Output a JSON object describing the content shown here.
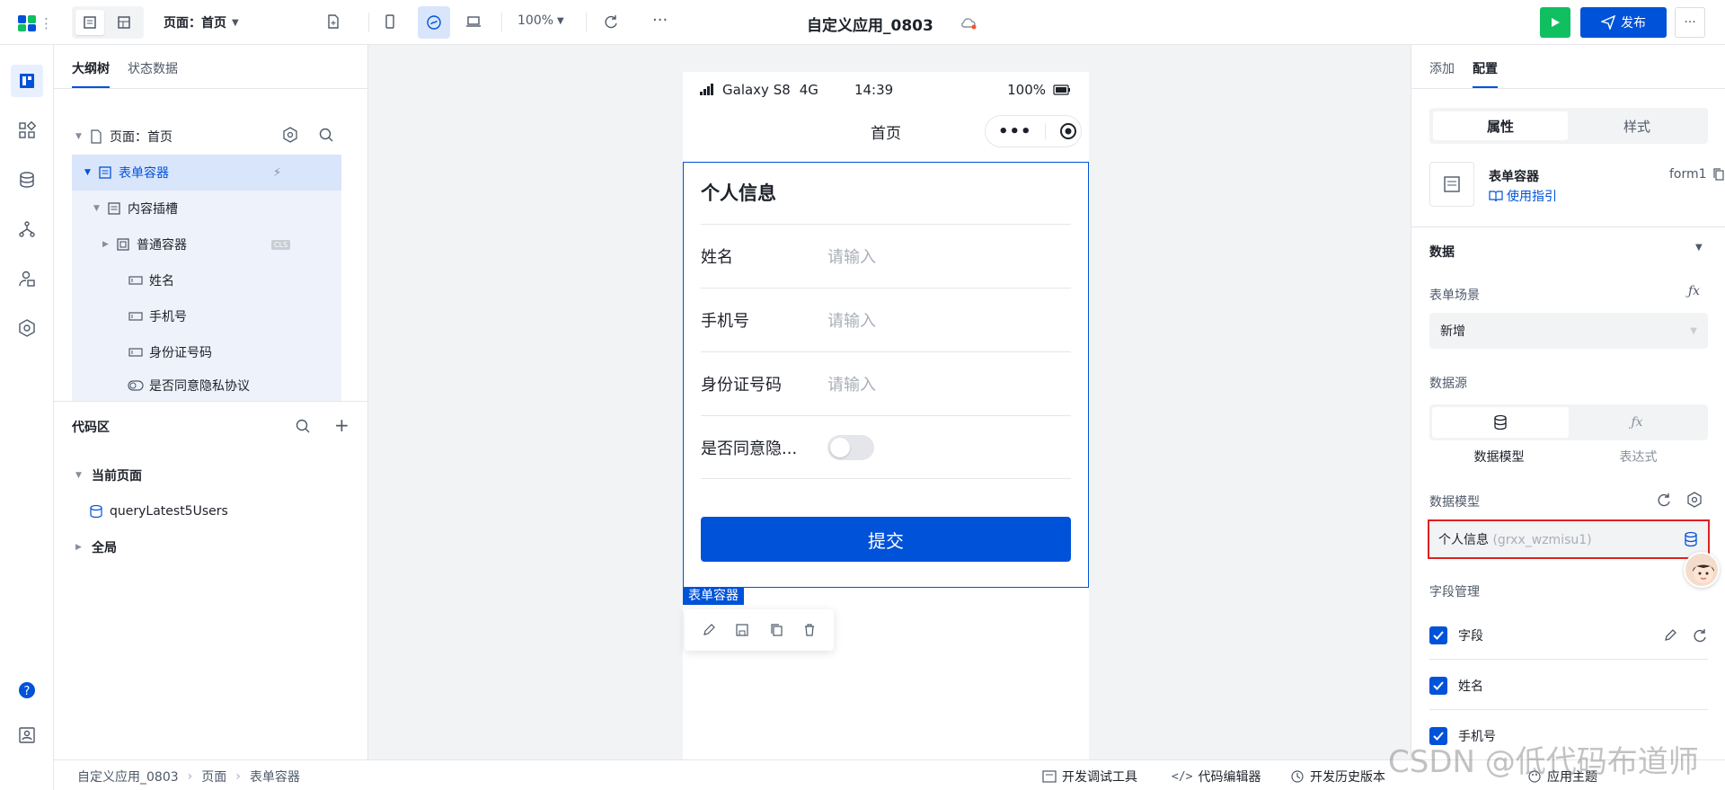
{
  "topbar": {
    "page_select": "页面：首页",
    "zoom": "100%",
    "app_title": "自定义应用_0803",
    "publish_label": "发布"
  },
  "outline": {
    "tabs": [
      "大纲树",
      "状态数据"
    ],
    "tree": [
      {
        "label": "页面：首页"
      },
      {
        "label": "表单容器"
      },
      {
        "label": "内容插槽"
      },
      {
        "label": "普通容器",
        "badge": "CLS"
      },
      {
        "label": "姓名"
      },
      {
        "label": "手机号"
      },
      {
        "label": "身份证号码"
      },
      {
        "label": "是否同意隐私协议"
      }
    ],
    "code_area_title": "代码区",
    "code_tree": [
      {
        "label": "当前页面"
      },
      {
        "label": "queryLatest5Users"
      },
      {
        "label": "全局"
      }
    ]
  },
  "phone": {
    "device": "Galaxy S8",
    "network": "4G",
    "time": "14:39",
    "battery": "100%",
    "nav_title": "首页",
    "form": {
      "title": "个人信息",
      "fields": [
        {
          "label": "姓名",
          "placeholder": "请输入"
        },
        {
          "label": "手机号",
          "placeholder": "请输入"
        },
        {
          "label": "身份证号码",
          "placeholder": "请输入"
        }
      ],
      "toggle_label": "是否同意隐...",
      "submit": "提交"
    },
    "selected_tag": "表单容器"
  },
  "right": {
    "tabs": [
      "添加",
      "配置"
    ],
    "segment": [
      "属性",
      "样式"
    ],
    "component_name": "表单容器",
    "component_guide": "使用指引",
    "component_id": "form1",
    "section_data": "数据",
    "form_scene_label": "表单场景",
    "form_scene_value": "新增",
    "datasource_label": "数据源",
    "datasource_options": [
      "数据模型",
      "表达式"
    ],
    "model_label": "数据模型",
    "model_value": "个人信息",
    "model_sub": "(grxx_wzmisu1)",
    "field_mgmt_label": "字段管理",
    "fields": [
      "字段",
      "姓名",
      "手机号"
    ]
  },
  "bottom": {
    "crumbs": [
      "自定义应用_0803",
      "页面",
      "表单容器"
    ],
    "tools": [
      "开发调试工具",
      "代码编辑器",
      "开发历史版本",
      "应用主题"
    ]
  },
  "watermark": "CSDN @低代码布道师",
  "colors": {
    "primary": "#0052d9",
    "success": "#0fbf60",
    "highlight": "#e02020"
  }
}
